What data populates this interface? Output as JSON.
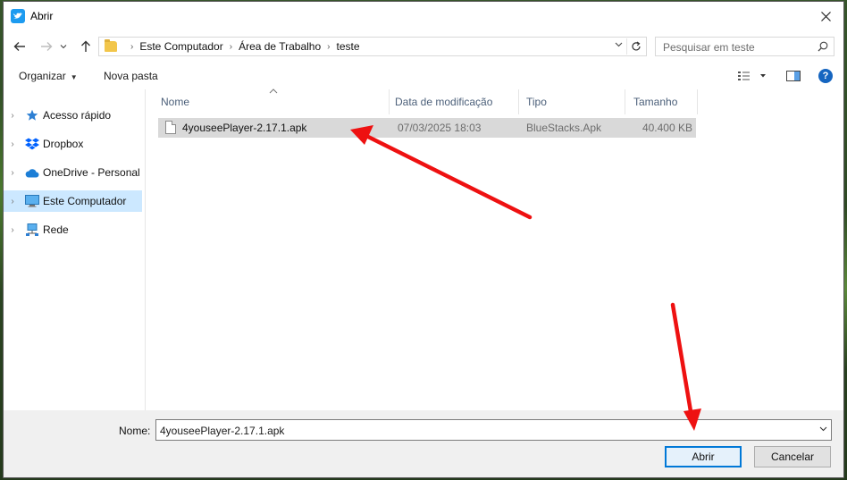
{
  "window": {
    "title": "Abrir",
    "app_icon": "bluestacks-bird-icon",
    "close_icon": "close-icon"
  },
  "nav": {
    "back_icon": "arrow-left-icon",
    "forward_icon": "arrow-right-icon",
    "recent_icon": "chevron-down-icon",
    "up_icon": "arrow-up-icon",
    "refresh_icon": "refresh-icon"
  },
  "address": {
    "crumbs": [
      "Este Computador",
      "Área de Trabalho",
      "teste"
    ]
  },
  "search": {
    "placeholder": "Pesquisar em teste"
  },
  "toolbar": {
    "organize_label": "Organizar",
    "new_folder_label": "Nova pasta"
  },
  "sidebar": {
    "items": [
      {
        "label": "Acesso rápido",
        "icon": "star-icon",
        "selected": false
      },
      {
        "label": "Dropbox",
        "icon": "dropbox-icon",
        "selected": false
      },
      {
        "label": "OneDrive - Personal",
        "icon": "cloud-icon",
        "selected": false
      },
      {
        "label": "Este Computador",
        "icon": "monitor-icon",
        "selected": true
      },
      {
        "label": "Rede",
        "icon": "network-icon",
        "selected": false
      }
    ]
  },
  "table": {
    "columns": [
      "Nome",
      "Data de modificação",
      "Tipo",
      "Tamanho"
    ],
    "rows": [
      {
        "name": "4youseePlayer-2.17.1.apk",
        "modified": "07/03/2025 18:03",
        "type": "BlueStacks.Apk",
        "size": "40.400 KB"
      }
    ]
  },
  "footer": {
    "name_label": "Nome:",
    "name_value": "4youseePlayer-2.17.1.apk",
    "open_label": "Abrir",
    "cancel_label": "Cancelar"
  },
  "colors": {
    "accent": "#0078d7",
    "selection": "#cce8ff",
    "row_highlight": "#d9d9d9",
    "annotation_arrow": "#ee1111"
  }
}
